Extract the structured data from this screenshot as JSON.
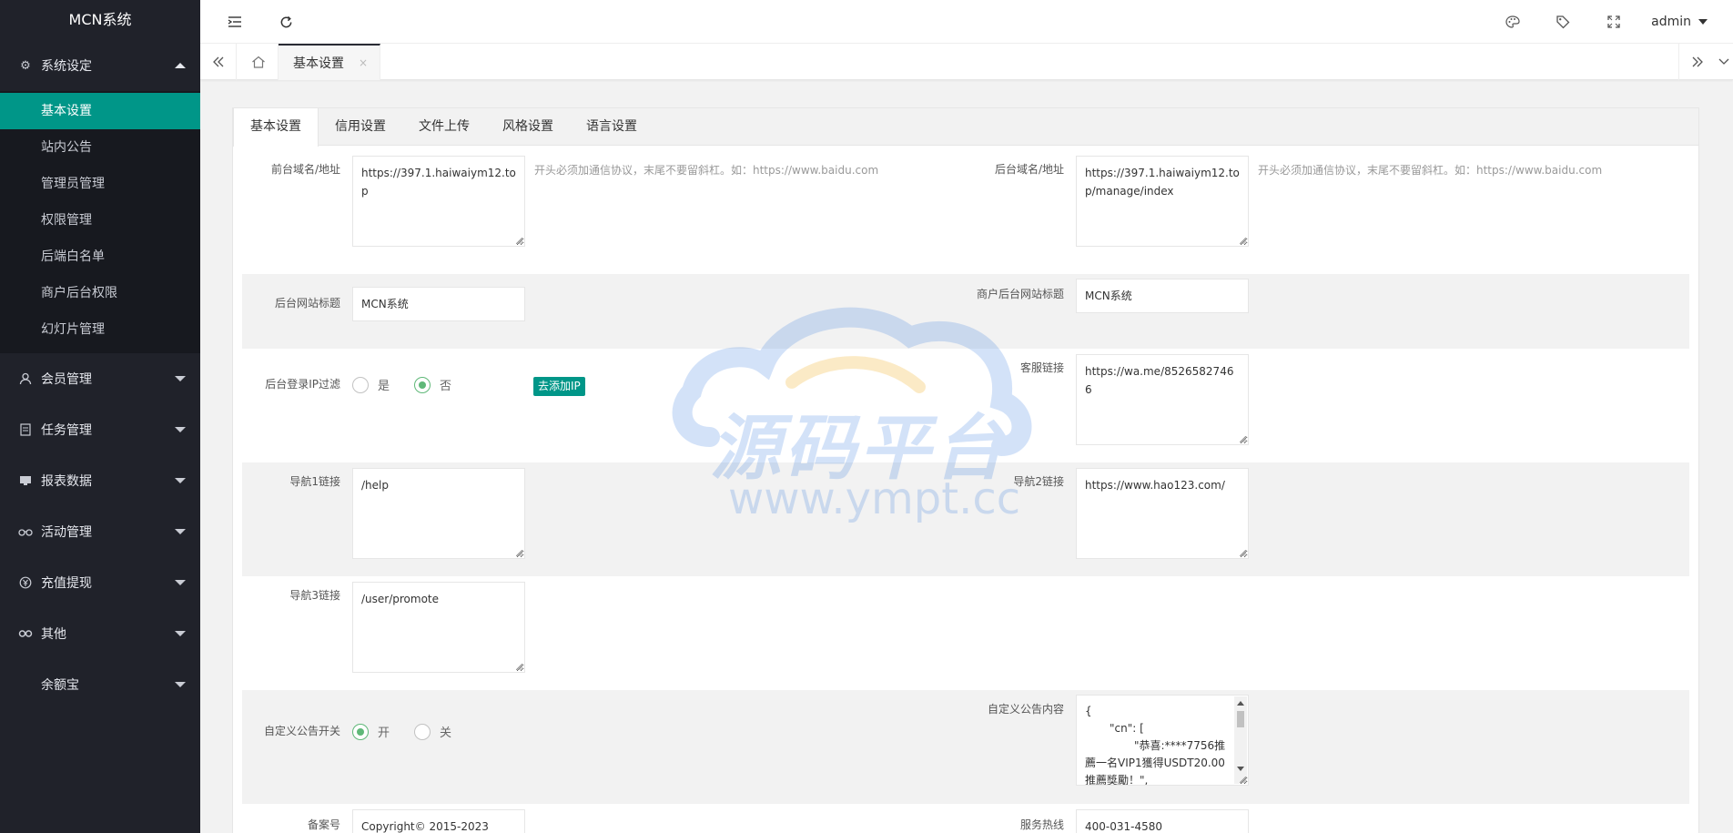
{
  "app": {
    "logo": "MCN系统"
  },
  "sidebar": {
    "groups": [
      {
        "label": "系统设定",
        "icon": "gear-icon",
        "expanded": true,
        "items": [
          "基本设置",
          "站内公告",
          "管理员管理",
          "权限管理",
          "后端白名单",
          "商户后台权限",
          "幻灯片管理"
        ]
      },
      {
        "label": "会员管理",
        "icon": "user-icon"
      },
      {
        "label": "任务管理",
        "icon": "task-icon"
      },
      {
        "label": "报表数据",
        "icon": "report-icon"
      },
      {
        "label": "活动管理",
        "icon": "activity-icon"
      },
      {
        "label": "充值提现",
        "icon": "recharge-icon"
      },
      {
        "label": "其他",
        "icon": "link-icon"
      },
      {
        "label": "余额宝",
        "icon": ""
      }
    ]
  },
  "header": {
    "user": "admin"
  },
  "tabsbar": {
    "current_tab": "基本设置",
    "close": "×"
  },
  "content_tabs": [
    "基本设置",
    "信用设置",
    "文件上传",
    "风格设置",
    "语言设置"
  ],
  "form": {
    "front_domain_label": "前台域名/地址",
    "front_domain_value": "https://397.1.haiwaiym12.top",
    "front_domain_hint": "开头必须加通信协议，末尾不要留斜杠。如：https://www.baidu.com",
    "back_domain_label": "后台域名/地址",
    "back_domain_value": "https://397.1.haiwaiym12.top/manage/index",
    "back_domain_hint": "开头必须加通信协议，末尾不要留斜杠。如：https://www.baidu.com",
    "site_title_label": "后台网站标题",
    "site_title_value": "MCN系统",
    "merchant_title_label": "商户后台网站标题",
    "merchant_title_value": "MCN系统",
    "ip_filter_label": "后台登录IP过滤",
    "ip_yes": "是",
    "ip_no": "否",
    "add_ip": "去添加IP",
    "service_link_label": "客服链接",
    "service_link_value": "https://wa.me/85265827466",
    "nav1_label": "导航1链接",
    "nav1_value": "/help",
    "nav2_label": "导航2链接",
    "nav2_value": "https://www.hao123.com/",
    "nav3_label": "导航3链接",
    "nav3_value": "/user/promote",
    "notice_switch_label": "自定义公告开关",
    "notice_on": "开",
    "notice_off": "关",
    "notice_content_label": "自定义公告内容",
    "notice_content_l1": "{",
    "notice_content_l2": "\"cn\": [",
    "notice_content_l3": "\"恭喜:****7756推",
    "notice_content_l4": "薦一名VIP1獲得USDT20.00",
    "notice_content_l5": "推薦獎勵！\",",
    "record_label": "备案号",
    "record_value": "Copyright© 2015-2023",
    "hotline_label": "服务热线",
    "hotline_value": "400-031-4580"
  },
  "watermark": {
    "text_cn": "源码平台",
    "text_url": "www.ympt.cc"
  },
  "colors": {
    "sidebar_bg": "#20222a",
    "active": "#009688",
    "radio_on": "#5fb878"
  }
}
